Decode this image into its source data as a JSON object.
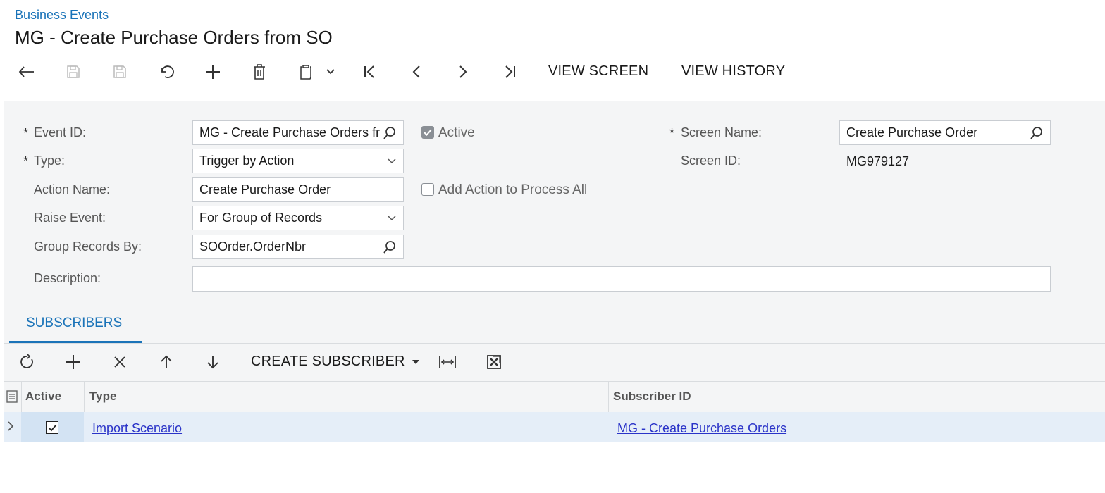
{
  "header": {
    "breadcrumb": "Business Events",
    "title": "MG - Create Purchase Orders from SO"
  },
  "toolbar": {
    "view_screen": "VIEW SCREEN",
    "view_history": "VIEW HISTORY"
  },
  "form": {
    "event_id_label": "Event ID:",
    "event_id_value": "MG - Create Purchase Orders from SO",
    "type_label": "Type:",
    "type_value": "Trigger by Action",
    "action_name_label": "Action Name:",
    "action_name_value": "Create Purchase Order",
    "raise_event_label": "Raise Event:",
    "raise_event_value": "For Group of Records",
    "group_by_label": "Group Records By:",
    "group_by_value": "SOOrder.OrderNbr",
    "description_label": "Description:",
    "description_value": "",
    "active_label": "Active",
    "active_checked": true,
    "add_action_label": "Add Action to Process All",
    "add_action_checked": false,
    "screen_name_label": "Screen Name:",
    "screen_name_value": "Create Purchase Order",
    "screen_id_label": "Screen ID:",
    "screen_id_value": "MG979127",
    "required_mark": "*"
  },
  "tabs": {
    "subscribers": "SUBSCRIBERS"
  },
  "grid": {
    "create_subscriber": "CREATE SUBSCRIBER",
    "columns": [
      "Active",
      "Type",
      "Subscriber ID"
    ],
    "rows": [
      {
        "active": true,
        "type": "Import Scenario",
        "subscriber_id": "MG - Create Purchase Orders"
      }
    ]
  },
  "colors": {
    "accent": "#1a73b8",
    "link": "#2a33c8",
    "selected_row": "#e5eef8"
  }
}
